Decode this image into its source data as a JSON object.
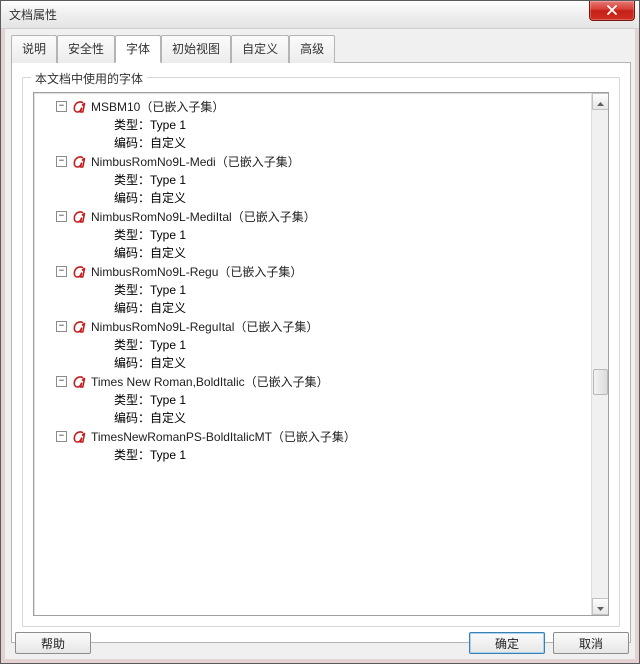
{
  "window": {
    "title": "文档属性"
  },
  "tabs": [
    {
      "label": "说明",
      "active": false
    },
    {
      "label": "安全性",
      "active": false
    },
    {
      "label": "字体",
      "active": true
    },
    {
      "label": "初始视图",
      "active": false
    },
    {
      "label": "自定义",
      "active": false
    },
    {
      "label": "高级",
      "active": false
    }
  ],
  "group": {
    "label": "本文档中使用的字体"
  },
  "labels": {
    "type_prefix": "类型：",
    "encoding_prefix": "编码：",
    "embedded_suffix": "（已嵌入子集）"
  },
  "fonts": [
    {
      "name": "MSBM10",
      "type": "Type 1",
      "encoding": "自定义"
    },
    {
      "name": "NimbusRomNo9L-Medi",
      "type": "Type 1",
      "encoding": "自定义"
    },
    {
      "name": "NimbusRomNo9L-MediItal",
      "type": "Type 1",
      "encoding": "自定义"
    },
    {
      "name": "NimbusRomNo9L-Regu",
      "type": "Type 1",
      "encoding": "自定义"
    },
    {
      "name": "NimbusRomNo9L-ReguItal",
      "type": "Type 1",
      "encoding": "自定义"
    },
    {
      "name": "Times New Roman,BoldItalic",
      "type": "Type 1",
      "encoding": "自定义"
    },
    {
      "name": "TimesNewRomanPS-BoldItalicMT",
      "type": "Type 1",
      "encoding": null
    }
  ],
  "buttons": {
    "help": "帮助",
    "ok": "确定",
    "cancel": "取消"
  },
  "colors": {
    "icon_red": "#c41c1c"
  },
  "twisty_minus": "−"
}
